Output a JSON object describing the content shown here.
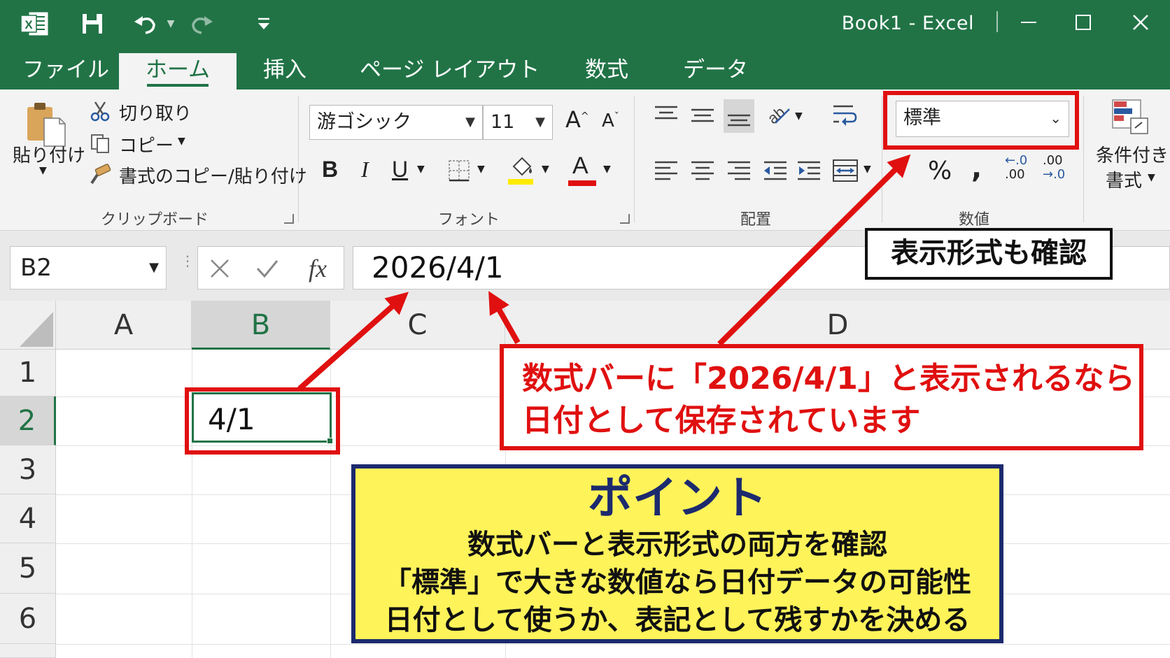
{
  "window": {
    "title": "Book1  -  Excel",
    "icons": [
      "excel-logo-icon",
      "save-icon",
      "undo-icon",
      "redo-icon",
      "customize-qat-icon",
      "minimize-icon",
      "maximize-icon",
      "close-icon"
    ]
  },
  "tabs": [
    "ファイル",
    "ホーム",
    "挿入",
    "ページ レイアウト",
    "数式",
    "データ"
  ],
  "active_tab": "ホーム",
  "ribbon": {
    "clipboard": {
      "paste": "貼り付け",
      "cut": "切り取り",
      "copy": "コピー",
      "format_painter": "書式のコピー/貼り付け",
      "label": "クリップボード"
    },
    "font": {
      "font_name": "游ゴシック",
      "font_size": "11",
      "grow": "A",
      "shrink": "A",
      "bold": "B",
      "italic": "I",
      "underline": "U",
      "font_color": "A",
      "label": "フォント"
    },
    "alignment": {
      "label": "配置"
    },
    "number": {
      "format": "標準",
      "percent": "%",
      "comma": ",",
      "inc_decimal_top": "←.0",
      "inc_decimal_bottom": ".00",
      "dec_decimal_top": ".00",
      "dec_decimal_bottom": "→.0",
      "label": "数値"
    },
    "styles": {
      "cond_format_1": "条件付き",
      "cond_format_2": "書式"
    }
  },
  "formula_bar": {
    "name_box": "B2",
    "fx": "fx",
    "formula": "2026/4/1"
  },
  "grid": {
    "columns": [
      "A",
      "B",
      "C",
      "D"
    ],
    "rows": [
      "1",
      "2",
      "3",
      "4",
      "5",
      "6"
    ],
    "selected_column": "B",
    "selected_row": "2",
    "cell_B2": "4/1"
  },
  "annotations": {
    "format_note": "表示形式も確認",
    "formula_note_line1": "数式バーに「2026/4/1」と表示されるなら",
    "formula_note_line2": "日付として保存されています",
    "point_title": "ポイント",
    "point_lines": [
      "数式バーと表示形式の両方を確認",
      "「標準」で大きな数値なら日付データの可能性",
      "日付として使うか、表記として残すかを決める"
    ]
  },
  "colors": {
    "excel_green": "#217346",
    "annotation_red": "#e01010",
    "point_yellow": "#fff35a",
    "point_navy": "#1c2a6e"
  }
}
